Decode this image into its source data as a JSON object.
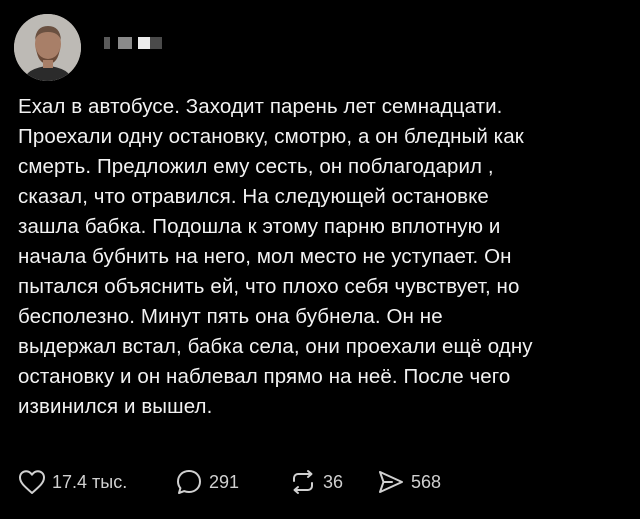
{
  "post": {
    "author": {
      "name_hidden": "█ ██"
    },
    "text": "Ехал в автобусе. Заходит парень лет семнадцати.\nПроехали одну остановку, смотрю, а он бледный как\nсмерть. Предложил ему сесть, он поблагодарил ,\nсказал, что отравился. На следующей остановке\nзашла бабка. Подошла к этому парню вплотную и\nначала бубнить на него, мол место не уступает. Он\nпытался объяснить ей, что плохо себя чувствует, но\nбесполезно. Минут пять она бубнела. Он не\nвыдержал встал, бабка села, они проехали ещё одну\nостановку и он наблевал прямо на неё. После чего\nизвинился и вышел.",
    "actions": {
      "likes": "17.4 тыс.",
      "comments": "291",
      "reposts": "36",
      "shares": "568"
    }
  },
  "colors": {
    "background": "#000000",
    "text": "#f2f2f2",
    "action_text": "#d0d0d0"
  },
  "icons": {
    "like": "heart-icon",
    "comment": "comment-bubble-icon",
    "repost": "repost-arrows-icon",
    "share": "share-arrow-icon"
  }
}
